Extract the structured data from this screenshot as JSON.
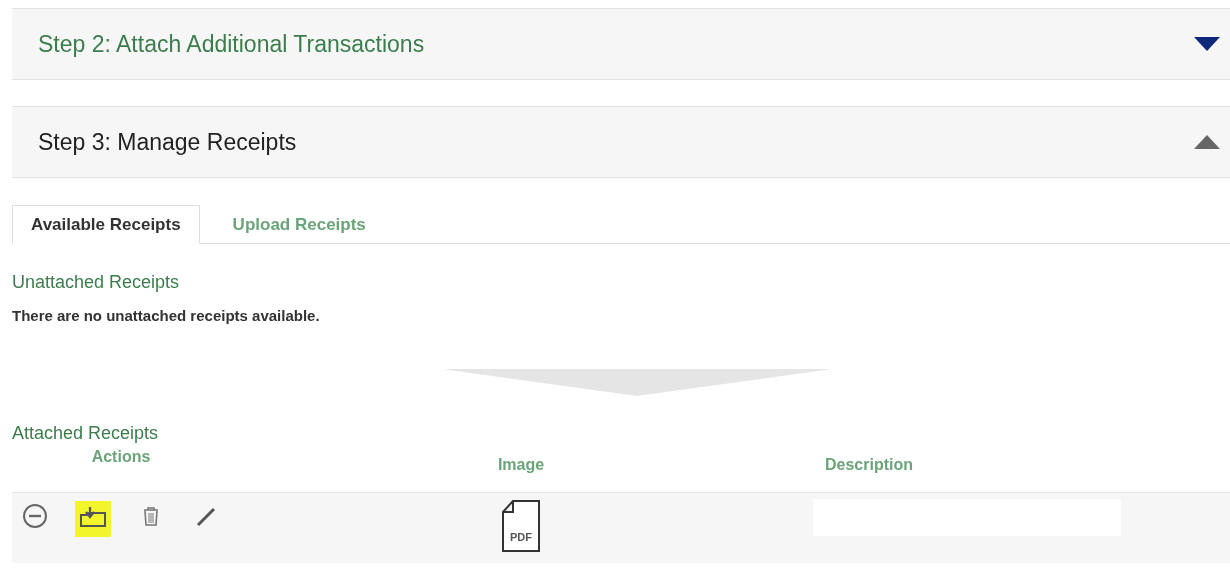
{
  "sections": [
    {
      "title": "Step 2: Attach Additional Transactions",
      "expanded": false
    },
    {
      "title": "Step 3: Manage Receipts",
      "expanded": true
    }
  ],
  "tabs": [
    {
      "label": "Available Receipts",
      "selected": true
    },
    {
      "label": "Upload Receipts",
      "selected": false
    }
  ],
  "unattached": {
    "heading": "Unattached Receipts",
    "message": "There are no unattached receipts available."
  },
  "attached": {
    "heading": "Attached Receipts",
    "columns": [
      "Actions",
      "Image",
      "Description"
    ],
    "rows": [
      {
        "actions": [
          {
            "kind": "remove",
            "highlighted": false
          },
          {
            "kind": "attach",
            "highlighted": true
          },
          {
            "kind": "delete",
            "highlighted": false
          },
          {
            "kind": "edit",
            "highlighted": false
          }
        ],
        "image": {
          "kind": "pdf",
          "label": "PDF"
        }
      }
    ]
  }
}
